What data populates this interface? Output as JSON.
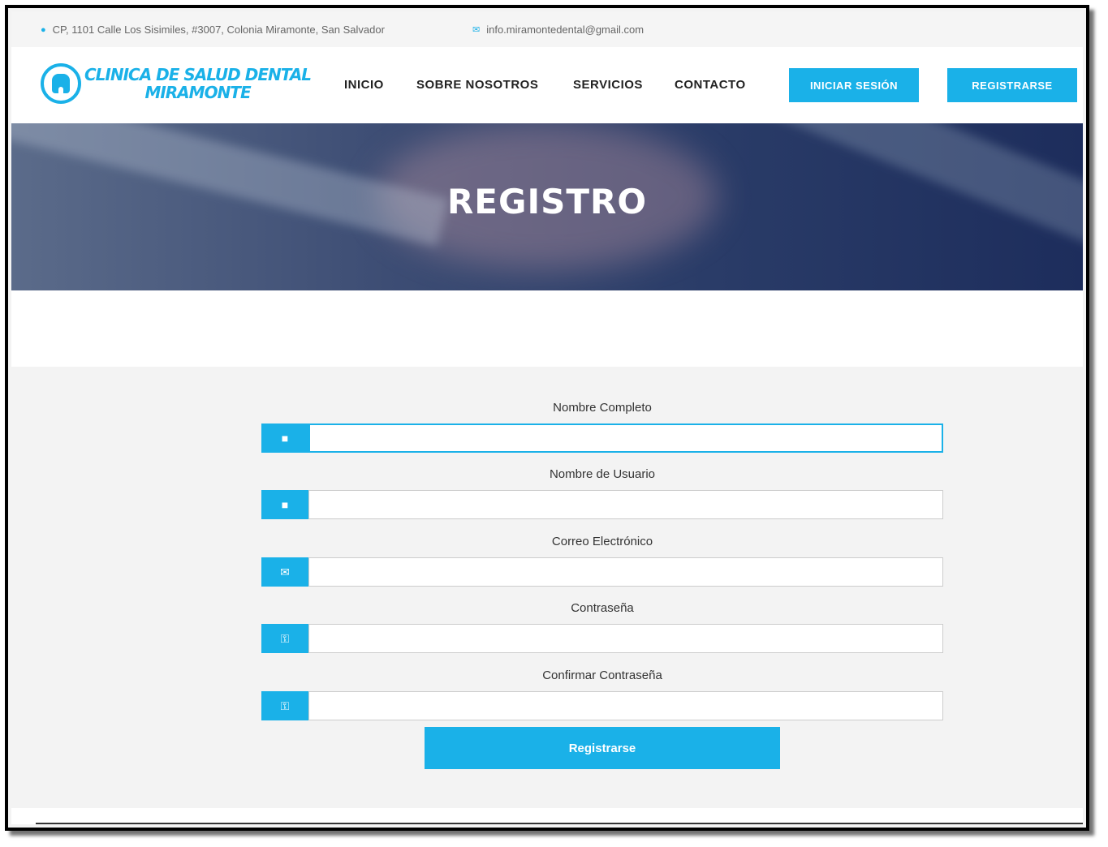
{
  "topbar": {
    "address": "CP, 1101 Calle Los Sisimiles, #3007, Colonia Miramonte, San Salvador",
    "email": "info.miramontedental@gmail.com"
  },
  "logo": {
    "line1": "CLINICA DE SALUD DENTAL",
    "line2": "MIRAMONTE"
  },
  "nav": {
    "inicio": "INICIO",
    "sobre": "SOBRE NOSOTROS",
    "servicios": "SERVICIOS",
    "contacto": "CONTACTO"
  },
  "header_buttons": {
    "login": "INICIAR SESIÓN",
    "register": "REGISTRARSE"
  },
  "hero": {
    "title": "REGISTRO"
  },
  "form": {
    "fields": [
      {
        "label": "Nombre Completo",
        "icon": "user-icon",
        "value": ""
      },
      {
        "label": "Nombre de Usuario",
        "icon": "user-icon",
        "value": ""
      },
      {
        "label": "Correo Electrónico",
        "icon": "envelope-icon",
        "value": ""
      },
      {
        "label": "Contraseña",
        "icon": "key-icon",
        "value": ""
      },
      {
        "label": "Confirmar Contraseña",
        "icon": "key-icon",
        "value": ""
      }
    ],
    "submit_label": "Registrarse"
  },
  "colors": {
    "accent": "#1ab1e8",
    "hero": "#2a3c68"
  }
}
